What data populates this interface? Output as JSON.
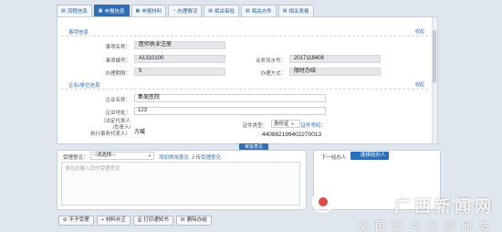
{
  "tabs": [
    {
      "label": "流程信息",
      "icon": "flow-icon",
      "active": false
    },
    {
      "label": "申报信息",
      "icon": "declare-icon",
      "active": true
    },
    {
      "label": "申报材料",
      "icon": "materials-icon",
      "active": false
    },
    {
      "label": "办理情况",
      "icon": "process-icon",
      "active": false
    },
    {
      "label": "相关审批",
      "icon": "approval-icon",
      "active": false
    },
    {
      "label": "相关办件",
      "icon": "cases-icon",
      "active": false
    },
    {
      "label": "相关表格",
      "icon": "forms-icon",
      "active": false
    }
  ],
  "matter": {
    "section_title": "事项信息",
    "toggle": "收起",
    "name_label": "事项名称：",
    "name_value": "医师执业注册",
    "code_label": "事项编号：",
    "code_value": "A1310100",
    "serial_label": "业务流水号：",
    "serial_value": "2017118406",
    "limit_label": "办理期限：",
    "limit_value": "5",
    "method_label": "办理方式：",
    "method_value": "限时办结"
  },
  "enterprise": {
    "section_title": "企业/单位信息",
    "toggle": "收起",
    "name_label": "企业名称：",
    "name_value": "集美医院",
    "address_label": "企业地址：",
    "address_value": "123",
    "legal_label_1": "（法定代表人",
    "legal_label_2": "/负责人/",
    "legal_label_3": "执行事务代表人）",
    "legal_value": "方臧",
    "id_type_label": "证件类型：",
    "id_type_value": "身份证",
    "id_number_label": "证件号码：",
    "id_number_value": "440882199402270013"
  },
  "review": {
    "tab_label": "审批意见",
    "opinion_label": "受理意见：",
    "opinion_select": "--请选择--",
    "common_link": "添加常用意见",
    "prev_link": "上传受理意见",
    "textarea_placeholder": "请在此输入您的受理意见"
  },
  "next_handler": {
    "label": "下一经办人",
    "button": "选择经办人"
  },
  "actions": [
    {
      "label": "不予受理",
      "icon": "block-icon"
    },
    {
      "label": "材料补正",
      "icon": "plus-icon"
    },
    {
      "label": "打印通知书",
      "icon": "print-icon"
    },
    {
      "label": "删除办结",
      "icon": "delete-icon"
    }
  ],
  "watermark": {
    "title": "广西新闻网",
    "url": "www.gxnews.com.cn",
    "subtitle": "全国重点新闻网站"
  },
  "colors": {
    "accent": "#2f6db5",
    "background": "#dfe6ee"
  }
}
